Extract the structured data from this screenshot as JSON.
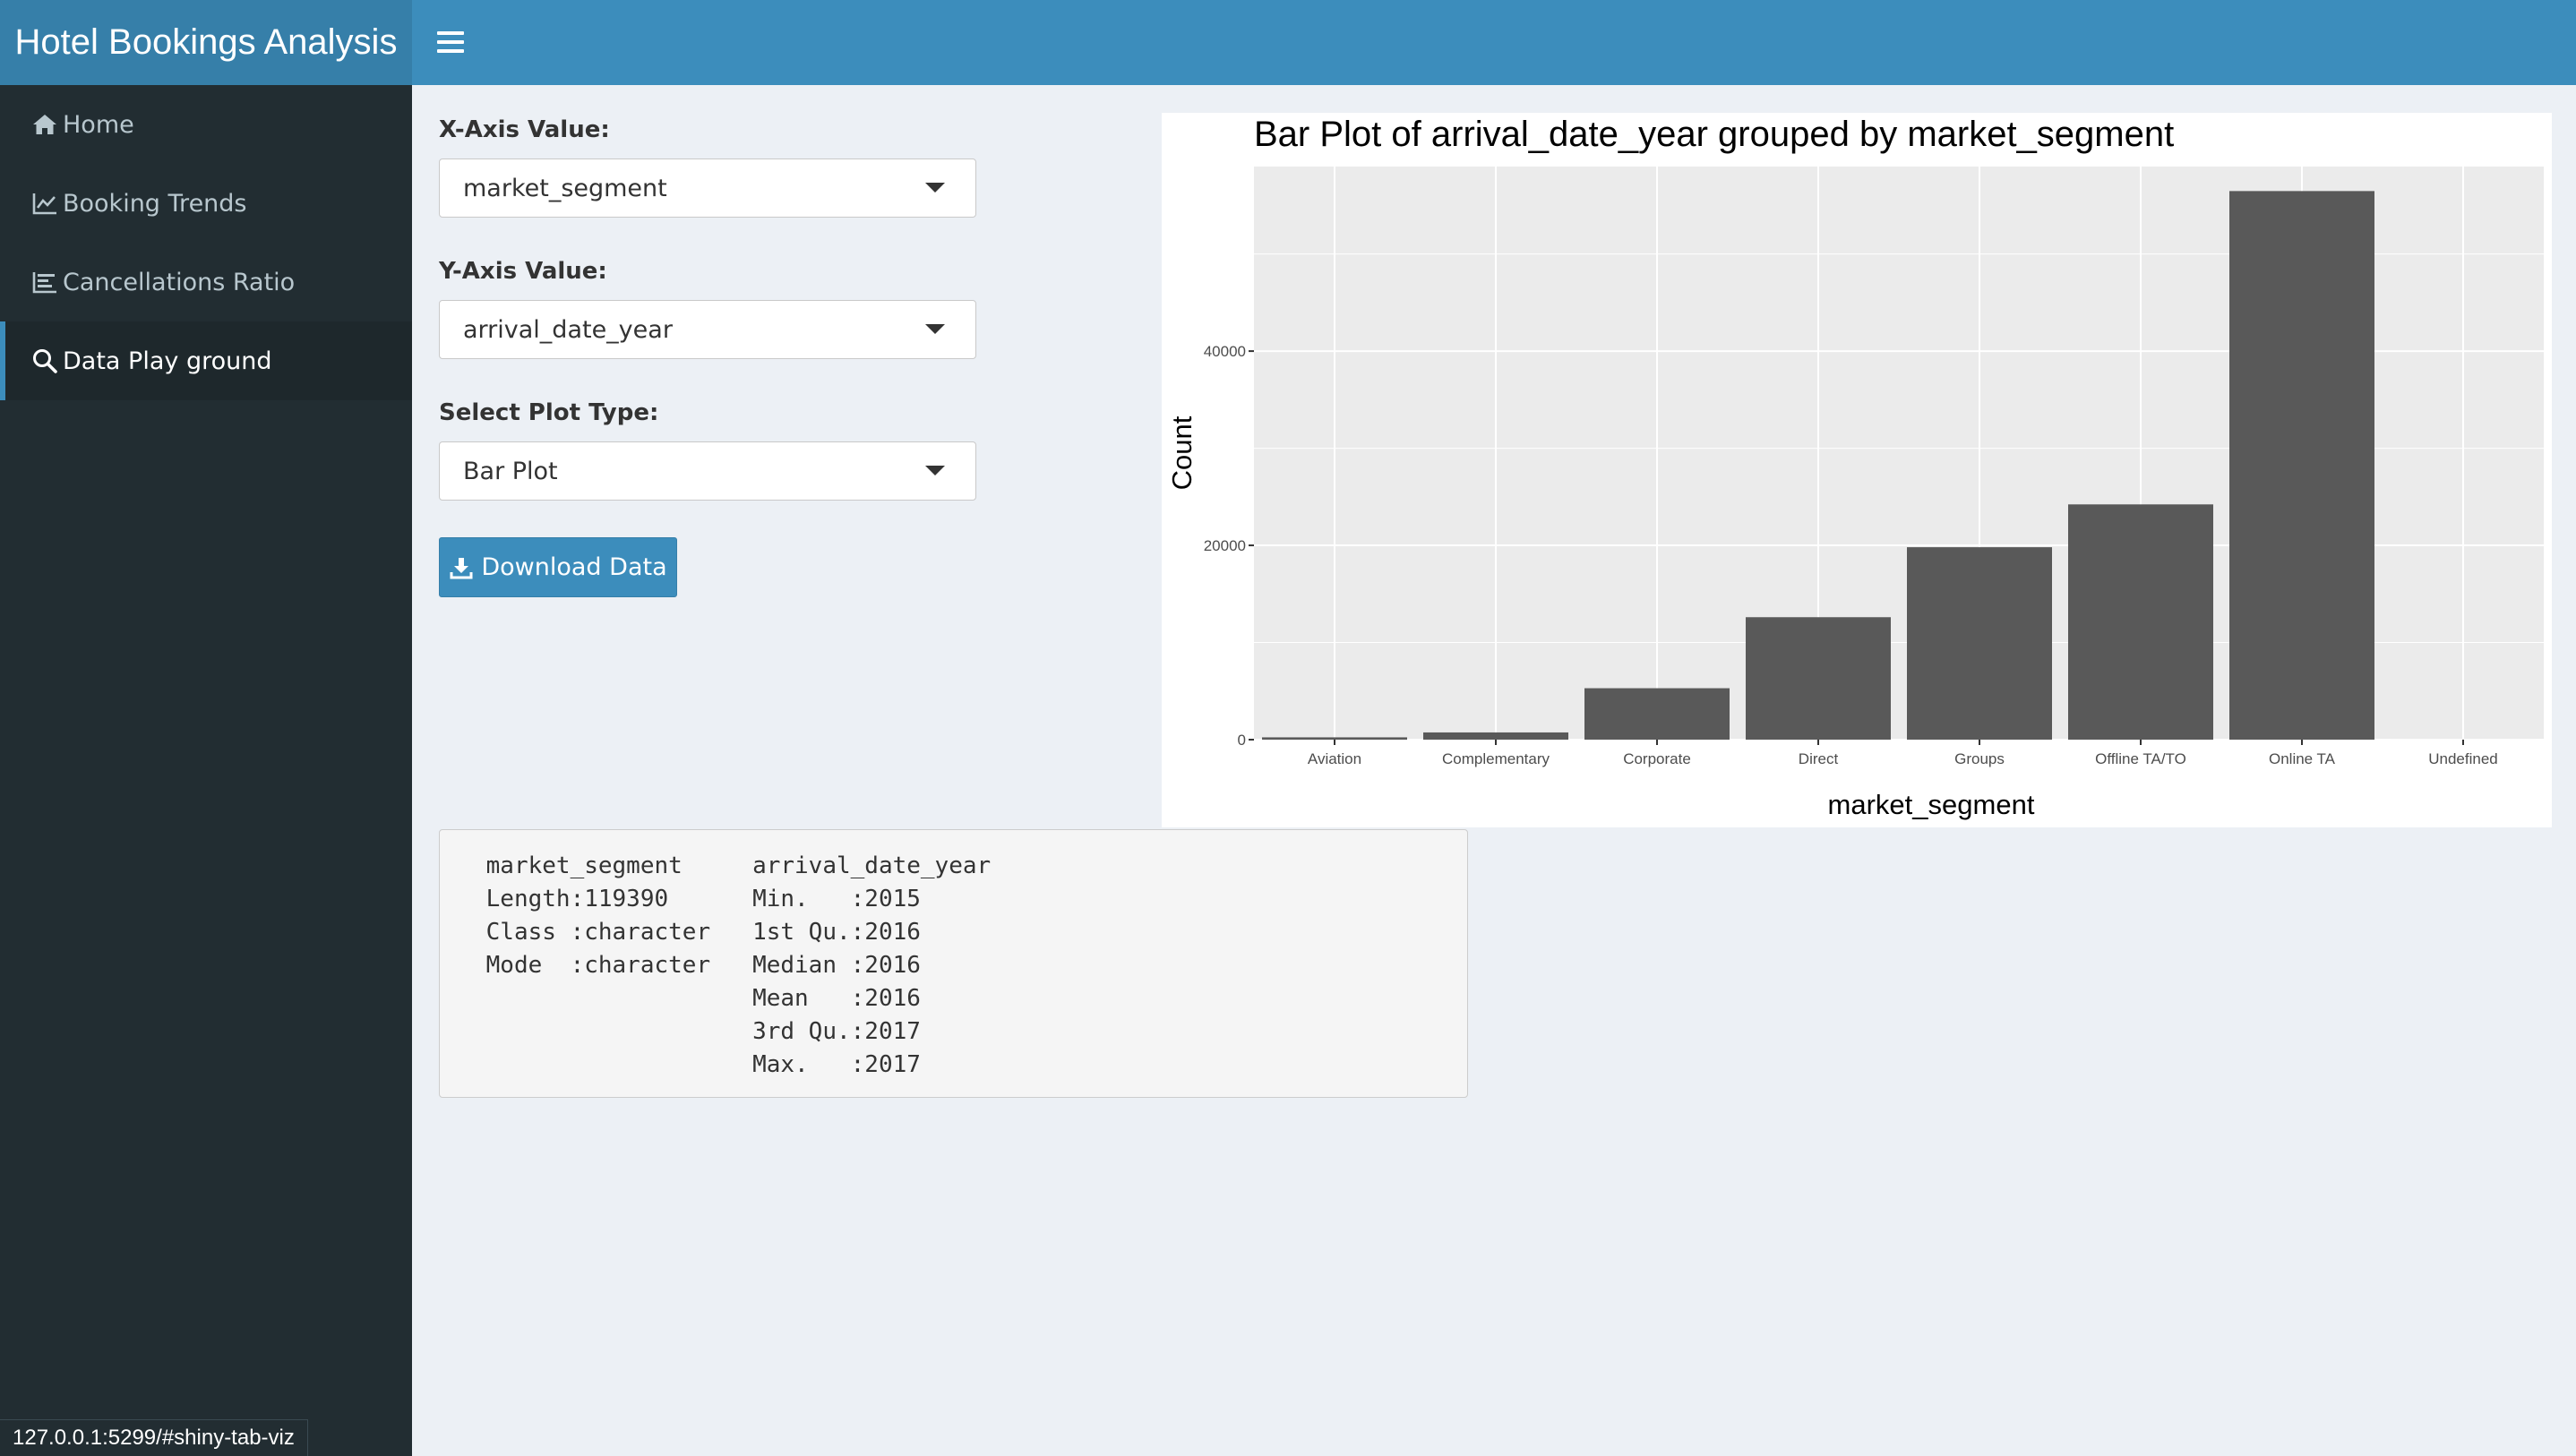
{
  "header": {
    "title": "Hotel Bookings Analysis"
  },
  "sidebar": {
    "items": [
      {
        "label": "Home",
        "icon": "home-icon"
      },
      {
        "label": "Booking Trends",
        "icon": "line-chart-icon"
      },
      {
        "label": "Cancellations Ratio",
        "icon": "bar-chart-icon"
      },
      {
        "label": "Data Play ground",
        "icon": "search-icon",
        "active": true
      }
    ]
  },
  "controls": {
    "x_label": "X-Axis Value:",
    "x_value": "market_segment",
    "y_label": "Y-Axis Value:",
    "y_value": "arrival_date_year",
    "plot_type_label": "Select Plot Type:",
    "plot_type_value": "Bar Plot",
    "download_label": "Download Data"
  },
  "chart_data": {
    "type": "bar",
    "title": "Bar Plot of arrival_date_year grouped by market_segment",
    "xlabel": "market_segment",
    "ylabel": "Count",
    "categories": [
      "Aviation",
      "Complementary",
      "Corporate",
      "Direct",
      "Groups",
      "Offline TA/TO",
      "Online TA",
      "Undefined"
    ],
    "values": [
      237,
      743,
      5295,
      12606,
      19811,
      24219,
      56477,
      2
    ],
    "yticks": [
      0,
      20000,
      40000
    ],
    "ylim": [
      0,
      59000
    ],
    "grid": true,
    "bar_color": "#595959",
    "panel_color": "#ebebeb"
  },
  "summary": {
    "lines": [
      " market_segment     arrival_date_year",
      " Length:119390      Min.   :2015     ",
      " Class :character   1st Qu.:2016     ",
      " Mode  :character   Median :2016     ",
      "                    Mean   :2016     ",
      "                    3rd Qu.:2017     ",
      "                    Max.   :2017     "
    ]
  },
  "status_url": "127.0.0.1:5299/#shiny-tab-viz",
  "colors": {
    "header": "#3c8dbc",
    "logo": "#367fa9",
    "sidebar": "#222d32",
    "content_bg": "#ecf0f5"
  }
}
